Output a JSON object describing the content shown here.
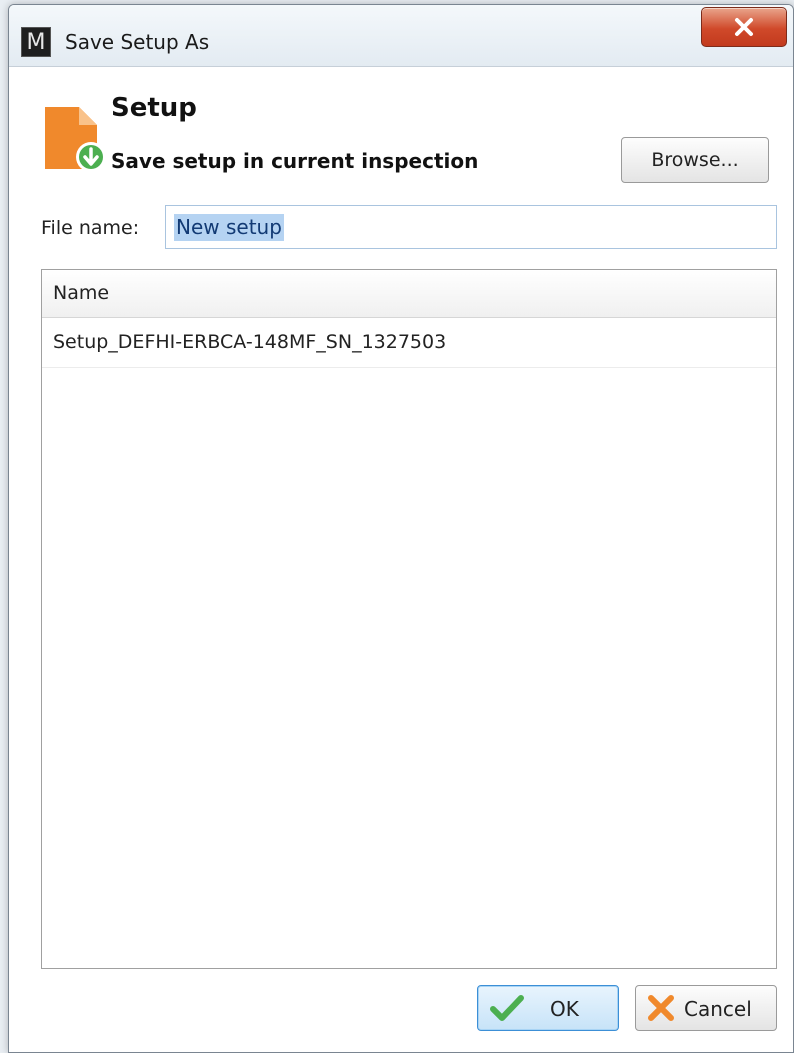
{
  "window": {
    "title": "Save Setup As",
    "app_icon_letter": "M"
  },
  "header": {
    "title": "Setup",
    "subtitle": "Save setup in current inspection",
    "browse_label": "Browse..."
  },
  "file": {
    "label": "File name:",
    "value": "New setup"
  },
  "list": {
    "column_header": "Name",
    "items": [
      {
        "name": "Setup_DEFHI-ERBCA-148MF_SN_1327503"
      }
    ]
  },
  "footer": {
    "ok_label": "OK",
    "cancel_label": "Cancel"
  },
  "icons": {
    "app": "app-logo-icon",
    "close": "close-icon",
    "setup": "document-download-icon",
    "ok": "checkmark-icon",
    "cancel": "x-icon"
  },
  "colors": {
    "accent_orange": "#f0892c",
    "accent_green": "#4caf50",
    "selection_blue": "#b5d3f2",
    "close_red": "#d0492a"
  }
}
